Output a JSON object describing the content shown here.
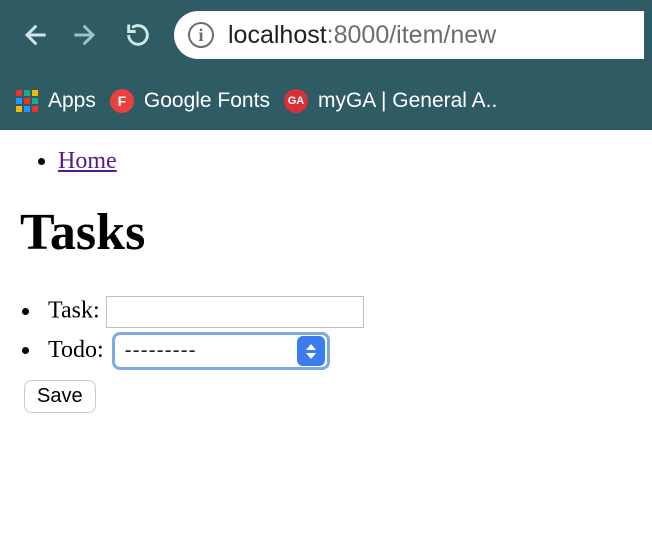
{
  "browser": {
    "url_host": "localhost",
    "url_port_path": ":8000/item/new",
    "bookmarks": {
      "apps": "Apps",
      "google_fonts": "Google Fonts",
      "myga": "myGA | General A..",
      "gf_badge": "F",
      "ga_badge": "GA"
    }
  },
  "nav": {
    "home": "Home"
  },
  "page": {
    "heading": "Tasks"
  },
  "form": {
    "task_label": "Task:",
    "task_value": "",
    "todo_label": "Todo:",
    "todo_selected": "---------",
    "save_label": "Save"
  }
}
